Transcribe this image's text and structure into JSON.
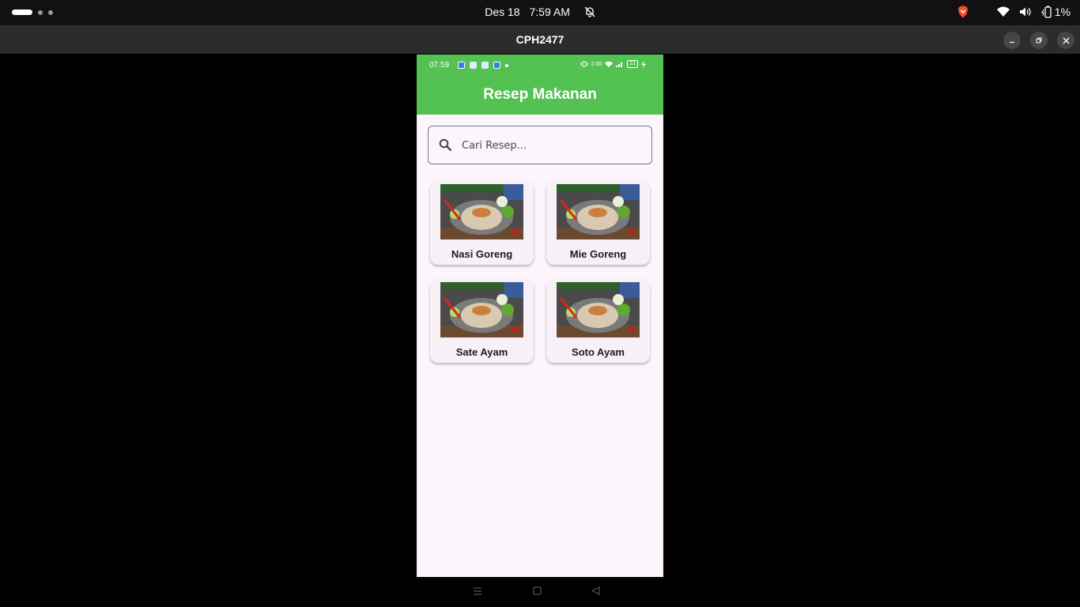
{
  "topbar": {
    "date": "Des 18",
    "time": "7:59 AM",
    "battery": "1%"
  },
  "window": {
    "title": "CPH2477"
  },
  "phone_status": {
    "time": "07.59",
    "speed": "2.00",
    "battery": "21"
  },
  "app": {
    "title": "Resep Makanan",
    "search_placeholder": "Cari Resep...",
    "recipes": [
      {
        "name": "Nasi Goreng"
      },
      {
        "name": "Mie Goreng"
      },
      {
        "name": "Sate Ayam"
      },
      {
        "name": "Soto Ayam"
      }
    ]
  },
  "colors": {
    "app_bar": "#53c253",
    "background": "#fcf6fc"
  }
}
